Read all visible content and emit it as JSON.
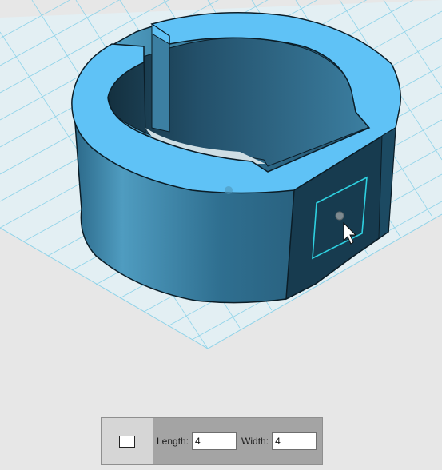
{
  "icons": {
    "cursor": "arrow-pointer-icon",
    "sketch_shape": "rectangle-icon"
  },
  "toolbar": {
    "length_label": "Length:",
    "length_value": "4",
    "width_label": "Width:",
    "width_value": "4"
  },
  "colors": {
    "background": "#e7e7e7",
    "grid_plane": "#e2eef2",
    "grid_lines": "#8fd3e9",
    "model_top": "#5fc2f6",
    "model_side": "#2f6e8f",
    "face_selected": "#173b4f",
    "sketch_outline": "#2ed0e0"
  }
}
